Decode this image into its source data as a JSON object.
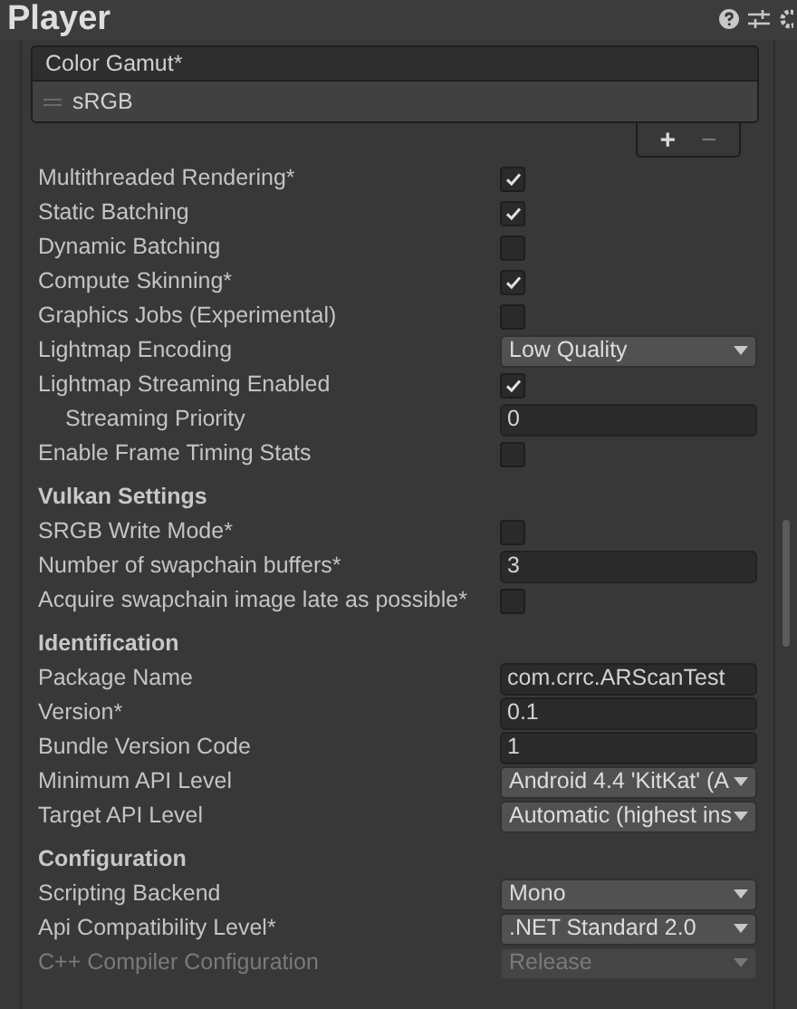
{
  "title": "Player",
  "color_gamut": {
    "header": "Color Gamut*",
    "items": [
      "sRGB"
    ],
    "add": "+",
    "remove": "−"
  },
  "rows": [
    {
      "kind": "checkbox",
      "label": "Multithreaded Rendering*",
      "checked": true
    },
    {
      "kind": "checkbox",
      "label": "Static Batching",
      "checked": true
    },
    {
      "kind": "checkbox",
      "label": "Dynamic Batching",
      "checked": false
    },
    {
      "kind": "checkbox",
      "label": "Compute Skinning*",
      "checked": true
    },
    {
      "kind": "checkbox",
      "label": "Graphics Jobs (Experimental)",
      "checked": false
    },
    {
      "kind": "dropdown",
      "label": "Lightmap Encoding",
      "value": "Low Quality"
    },
    {
      "kind": "checkbox",
      "label": "Lightmap Streaming Enabled",
      "checked": true
    },
    {
      "kind": "text",
      "label": "Streaming Priority",
      "value": "0",
      "indented": true
    },
    {
      "kind": "checkbox",
      "label": "Enable Frame Timing Stats",
      "checked": false
    },
    {
      "kind": "header",
      "label": "Vulkan Settings"
    },
    {
      "kind": "checkbox",
      "label": "SRGB Write Mode*",
      "checked": false
    },
    {
      "kind": "text",
      "label": "Number of swapchain buffers*",
      "value": "3"
    },
    {
      "kind": "checkbox",
      "label": "Acquire swapchain image late as possible*",
      "checked": false
    },
    {
      "kind": "header",
      "label": "Identification"
    },
    {
      "kind": "text",
      "label": "Package Name",
      "value": "com.crrc.ARScanTest"
    },
    {
      "kind": "text",
      "label": "Version*",
      "value": "0.1"
    },
    {
      "kind": "text",
      "label": "Bundle Version Code",
      "value": "1"
    },
    {
      "kind": "dropdown",
      "label": "Minimum API Level",
      "value": "Android 4.4 'KitKat' (A"
    },
    {
      "kind": "dropdown",
      "label": "Target API Level",
      "value": "Automatic (highest ins"
    },
    {
      "kind": "header",
      "label": "Configuration"
    },
    {
      "kind": "dropdown",
      "label": "Scripting Backend",
      "value": "Mono"
    },
    {
      "kind": "dropdown",
      "label": "Api Compatibility Level*",
      "value": ".NET Standard 2.0"
    },
    {
      "kind": "dropdown",
      "label": "C++ Compiler Configuration",
      "value": "Release",
      "disabled": true
    }
  ]
}
